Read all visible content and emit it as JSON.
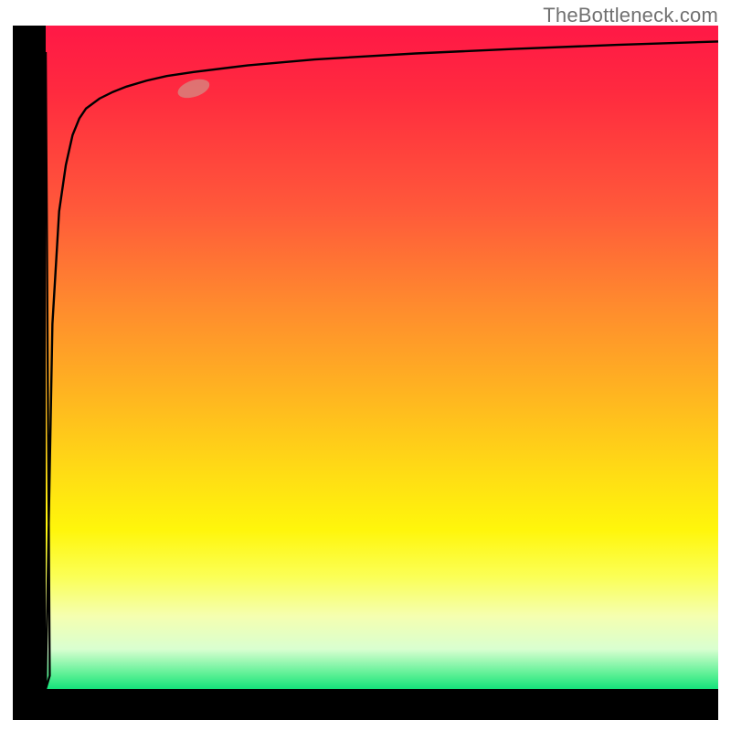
{
  "watermark": "TheBottleneck.com",
  "colors": {
    "gradient_top": "#ff1846",
    "gradient_mid1": "#ff8a2e",
    "gradient_mid2": "#ffde14",
    "gradient_bottom": "#15e27b",
    "curve": "#000000",
    "marker": "#d68880",
    "axis": "#000000"
  },
  "marker": {
    "x_frac": 0.22,
    "y_frac": 0.095
  },
  "chart_data": {
    "type": "line",
    "title": "",
    "xlabel": "",
    "ylabel": "",
    "xlim": [
      0,
      100
    ],
    "ylim": [
      0,
      100
    ],
    "grid": false,
    "series": [
      {
        "name": "curve",
        "x": [
          0,
          1,
          2,
          3,
          4,
          5,
          6,
          8,
          10,
          12,
          15,
          18,
          22,
          30,
          40,
          55,
          70,
          85,
          100
        ],
        "y": [
          0,
          55,
          72,
          79,
          83.5,
          86,
          87.5,
          89,
          90,
          90.8,
          91.7,
          92.4,
          93.0,
          94.0,
          94.9,
          95.8,
          96.5,
          97.1,
          97.6
        ]
      }
    ],
    "annotations": [
      {
        "kind": "marker",
        "x": 22,
        "y": 90.5
      }
    ],
    "background": "vertical-gradient red→yellow→green"
  }
}
